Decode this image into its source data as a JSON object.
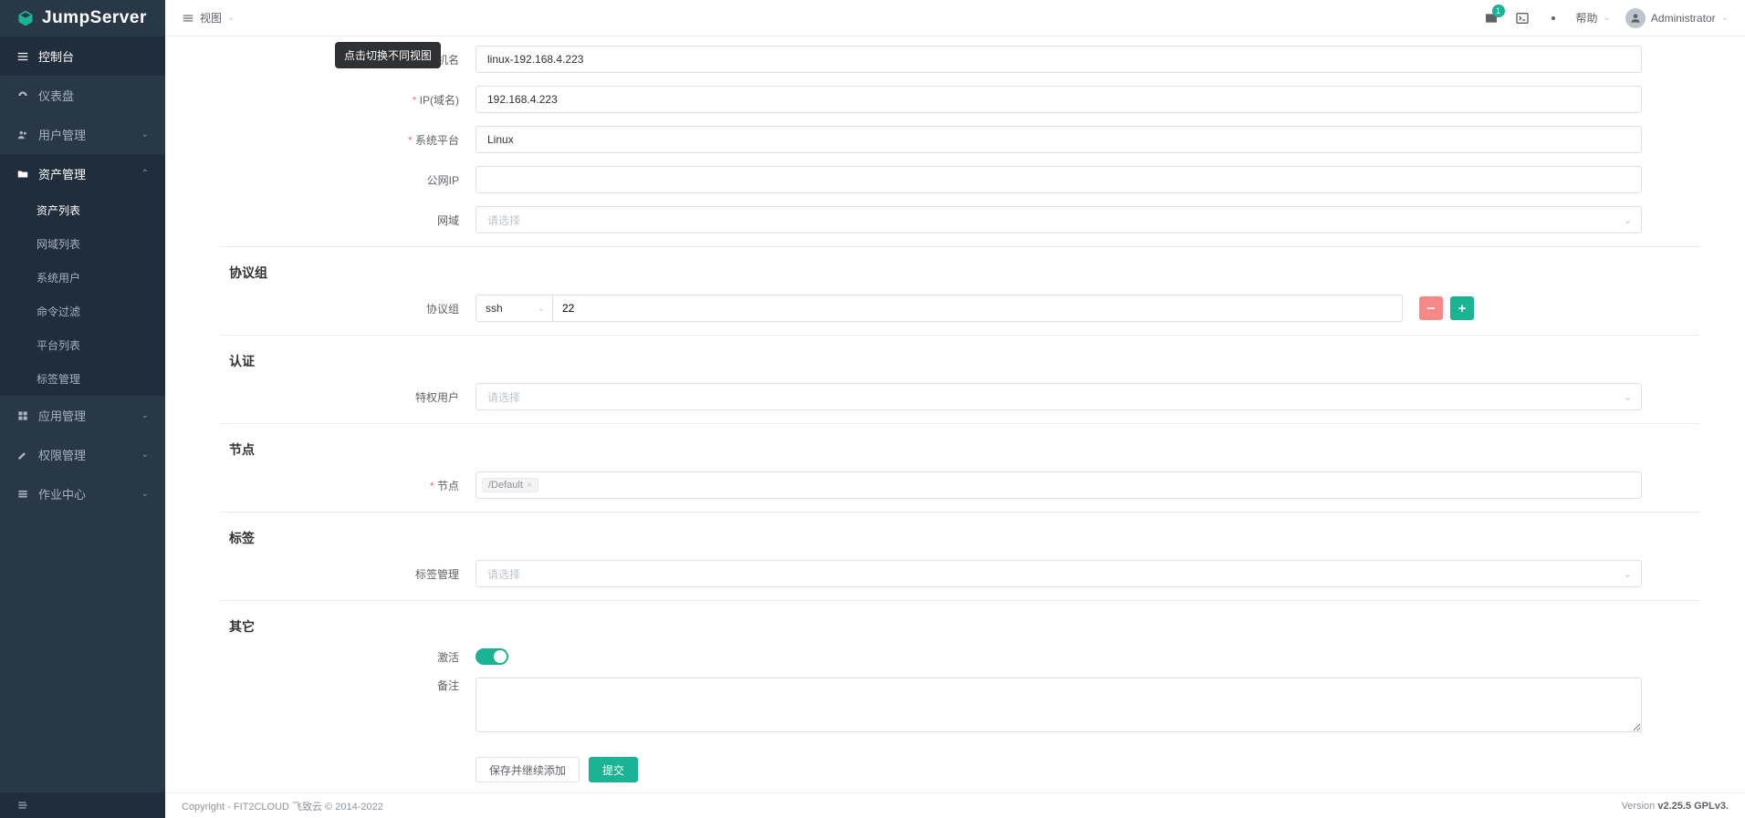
{
  "brand": "JumpServer",
  "sidebar": {
    "header": "控制台",
    "items": [
      {
        "label": "仪表盘",
        "icon": "dashboard"
      },
      {
        "label": "用户管理",
        "icon": "users",
        "expandable": true
      },
      {
        "label": "资产管理",
        "icon": "folder",
        "expandable": true,
        "active": true,
        "children": [
          "资产列表",
          "网域列表",
          "系统用户",
          "命令过滤",
          "平台列表",
          "标签管理"
        ],
        "activeChild": 0
      },
      {
        "label": "应用管理",
        "icon": "grid",
        "expandable": true
      },
      {
        "label": "权限管理",
        "icon": "edit",
        "expandable": true
      },
      {
        "label": "作业中心",
        "icon": "tasks",
        "expandable": true
      }
    ]
  },
  "topbar": {
    "view_label": "视图",
    "tooltip": "点击切换不同视图",
    "mail_badge": "1",
    "help": "帮助",
    "user": "Administrator"
  },
  "form": {
    "fields": {
      "hostname": {
        "label": "主机名",
        "value": "linux-192.168.4.223"
      },
      "ip": {
        "label": "IP(域名)",
        "value": "192.168.4.223"
      },
      "platform": {
        "label": "系统平台",
        "value": "Linux"
      },
      "public_ip": {
        "label": "公网IP",
        "value": ""
      },
      "domain": {
        "label": "网域",
        "placeholder": "请选择"
      }
    },
    "protocol_section": "协议组",
    "protocol": {
      "label": "协议组",
      "name": "ssh",
      "port": "22"
    },
    "auth_section": "认证",
    "admin_user": {
      "label": "特权用户",
      "placeholder": "请选择"
    },
    "node_section": "节点",
    "node": {
      "label": "节点",
      "tag": "/Default"
    },
    "label_section": "标签",
    "labels": {
      "label": "标签管理",
      "placeholder": "请选择"
    },
    "other_section": "其它",
    "active": {
      "label": "激活"
    },
    "comment": {
      "label": "备注",
      "value": ""
    },
    "buttons": {
      "save_continue": "保存并继续添加",
      "submit": "提交"
    }
  },
  "footer": {
    "copyright": "Copyright - FIT2CLOUD 飞致云 © 2014-2022",
    "version_label": "Version ",
    "version": "v2.25.5 GPLv3."
  }
}
